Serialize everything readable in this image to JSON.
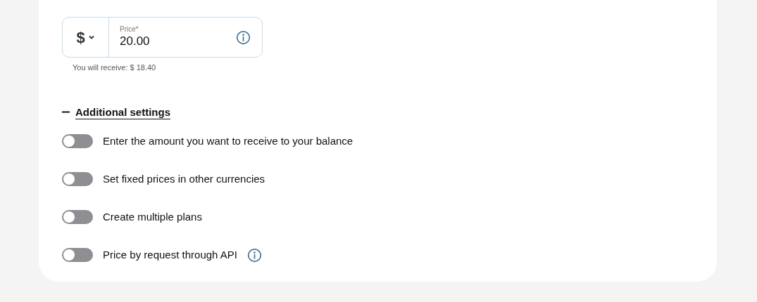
{
  "price_field": {
    "currency": "$",
    "label": "Price*",
    "value": "20.00",
    "hint": "You will receive: $ 18.40"
  },
  "additional_settings": {
    "label": "Additional settings",
    "expanded": true,
    "options": [
      {
        "label": "Enter the amount you want to receive to your balance",
        "on": false,
        "info": false
      },
      {
        "label": "Set fixed prices in other currencies",
        "on": false,
        "info": false
      },
      {
        "label": "Create multiple plans",
        "on": false,
        "info": false
      },
      {
        "label": "Price by request through API",
        "on": false,
        "info": true
      }
    ]
  }
}
